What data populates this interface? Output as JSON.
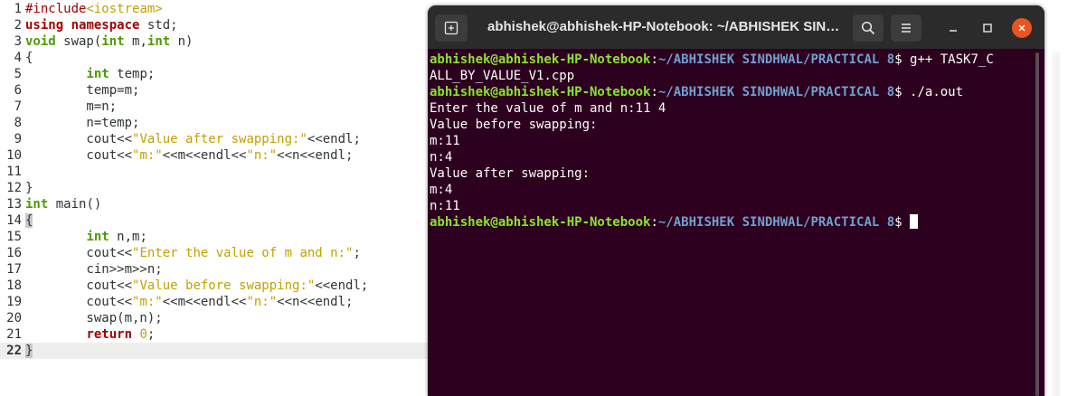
{
  "editor": {
    "line_numbers": [
      "1",
      "2",
      "3",
      "4",
      "5",
      "6",
      "7",
      "8",
      "9",
      "10",
      "11",
      "12",
      "13",
      "14",
      "15",
      "16",
      "17",
      "18",
      "19",
      "20",
      "21",
      "22"
    ],
    "current_line": "22",
    "lines": [
      [
        {
          "t": "#include",
          "c": "pp"
        },
        {
          "t": "<iostream>",
          "c": "str"
        }
      ],
      [
        {
          "t": "using",
          "c": "kw"
        },
        {
          "t": " "
        },
        {
          "t": "namespace",
          "c": "kw"
        },
        {
          "t": " std;"
        }
      ],
      [
        {
          "t": "void",
          "c": "ty"
        },
        {
          "t": " swap("
        },
        {
          "t": "int",
          "c": "ty"
        },
        {
          "t": " m,"
        },
        {
          "t": "int",
          "c": "ty"
        },
        {
          "t": " n)"
        }
      ],
      [
        {
          "t": "{"
        }
      ],
      [
        {
          "t": "        "
        },
        {
          "t": "int",
          "c": "ty"
        },
        {
          "t": " temp;"
        }
      ],
      [
        {
          "t": "        temp=m;"
        }
      ],
      [
        {
          "t": "        m=n;"
        }
      ],
      [
        {
          "t": "        n=temp;"
        }
      ],
      [
        {
          "t": "        cout<<"
        },
        {
          "t": "\"Value after swapping:\"",
          "c": "str"
        },
        {
          "t": "<<endl;"
        }
      ],
      [
        {
          "t": "        cout<<"
        },
        {
          "t": "\"m:\"",
          "c": "str"
        },
        {
          "t": "<<m<<endl<<"
        },
        {
          "t": "\"n:\"",
          "c": "str"
        },
        {
          "t": "<<n<<endl;"
        }
      ],
      [],
      [
        {
          "t": "}"
        }
      ],
      [
        {
          "t": "int",
          "c": "ty"
        },
        {
          "t": " main()"
        }
      ],
      [
        {
          "t": "{",
          "c": "brace-hl"
        }
      ],
      [
        {
          "t": "        "
        },
        {
          "t": "int",
          "c": "ty"
        },
        {
          "t": " n,m;"
        }
      ],
      [
        {
          "t": "        cout<<"
        },
        {
          "t": "\"Enter the value of m and n:\"",
          "c": "str"
        },
        {
          "t": ";"
        }
      ],
      [
        {
          "t": "        cin>>m>>n;"
        }
      ],
      [
        {
          "t": "        cout<<"
        },
        {
          "t": "\"Value before swapping:\"",
          "c": "str"
        },
        {
          "t": "<<endl;"
        }
      ],
      [
        {
          "t": "        cout<<"
        },
        {
          "t": "\"m:\"",
          "c": "str"
        },
        {
          "t": "<<m<<endl<<"
        },
        {
          "t": "\"n:\"",
          "c": "str"
        },
        {
          "t": "<<n<<endl;"
        }
      ],
      [
        {
          "t": "        swap(m,n);"
        }
      ],
      [
        {
          "t": "        "
        },
        {
          "t": "return",
          "c": "kw"
        },
        {
          "t": " "
        },
        {
          "t": "0",
          "c": "num"
        },
        {
          "t": ";"
        }
      ],
      [
        {
          "t": "}",
          "c": "brace-hl"
        }
      ]
    ]
  },
  "terminal": {
    "title": "abhishek@abhishek-HP-Notebook: ~/ABHISHEK SIN…",
    "icons": {
      "new_tab": "new-tab-icon",
      "search": "search-icon",
      "menu": "hamburger-menu-icon",
      "minimize": "minimize-icon",
      "maximize": "maximize-icon",
      "close": "close-icon"
    },
    "close_color": "#e95420",
    "lines": [
      {
        "user": "abhishek@abhishek-HP-Notebook",
        "colon": ":",
        "path": "~/ABHISHEK SINDHWAL/PRACTICAL 8",
        "sym": "$ ",
        "cmd": "g++ TASK7_C"
      },
      {
        "text": "ALL_BY_VALUE_V1.cpp"
      },
      {
        "user": "abhishek@abhishek-HP-Notebook",
        "colon": ":",
        "path": "~/ABHISHEK SINDHWAL/PRACTICAL 8",
        "sym": "$ ",
        "cmd": "./a.out"
      },
      {
        "text": "Enter the value of m and n:11 4"
      },
      {
        "text": "Value before swapping:"
      },
      {
        "text": "m:11"
      },
      {
        "text": "n:4"
      },
      {
        "text": "Value after swapping:"
      },
      {
        "text": "m:4"
      },
      {
        "text": "n:11"
      },
      {
        "user": "abhishek@abhishek-HP-Notebook",
        "colon": ":",
        "path": "~/ABHISHEK SINDHWAL/PRACTICAL 8",
        "sym": "$ ",
        "cmd": "",
        "cursor": true
      }
    ]
  }
}
